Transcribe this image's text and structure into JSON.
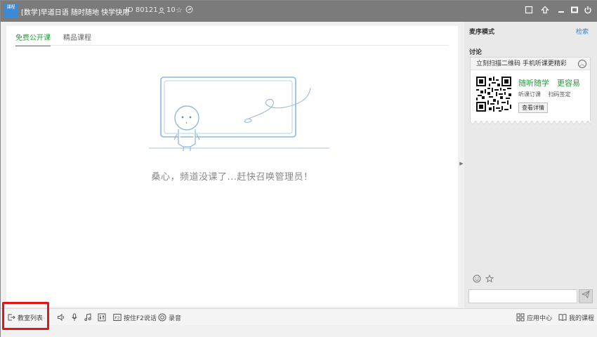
{
  "window": {
    "logo_text": "课程",
    "title": "[数学]早道日语 随时随地 快学快用",
    "channel_id": "ID 80121",
    "user_count": "10"
  },
  "main": {
    "tabs": [
      {
        "label": "免费公开课",
        "active": true
      },
      {
        "label": "精品课程",
        "active": false
      }
    ],
    "empty_message": "桑心，频道没课了...赶快召唤管理员！"
  },
  "sidebar": {
    "mode_label": "麦序模式",
    "mode_toggle": "检索",
    "discuss_label": "讨论",
    "promo": {
      "header": "立刻扫描二维码 手机听课更精彩",
      "slogan": "随听随学　更容易",
      "sub": "听课订课　 扫码签定",
      "button": "查看详情"
    }
  },
  "toolbar": {
    "classroom_list": "教室列表",
    "press_f2": "按住F2说话",
    "record": "录音",
    "app_center": "应用中心",
    "my_courses": "我的课程"
  },
  "colors": {
    "accent_green": "#2a9b3a",
    "titlebar": "#7b7b7b",
    "highlight_red": "#e0161b",
    "link_blue": "#3b83c7"
  }
}
